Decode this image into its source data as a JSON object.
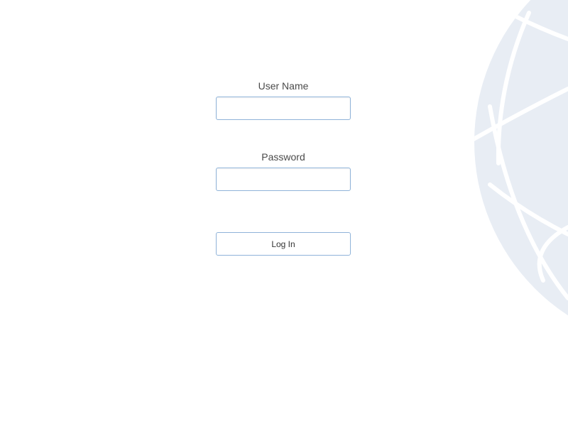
{
  "login": {
    "username_label": "User Name",
    "username_value": "",
    "password_label": "Password",
    "password_value": "",
    "submit_label": "Log In"
  },
  "background": {
    "icon": "globe-icon",
    "color": "#e8edf4"
  }
}
